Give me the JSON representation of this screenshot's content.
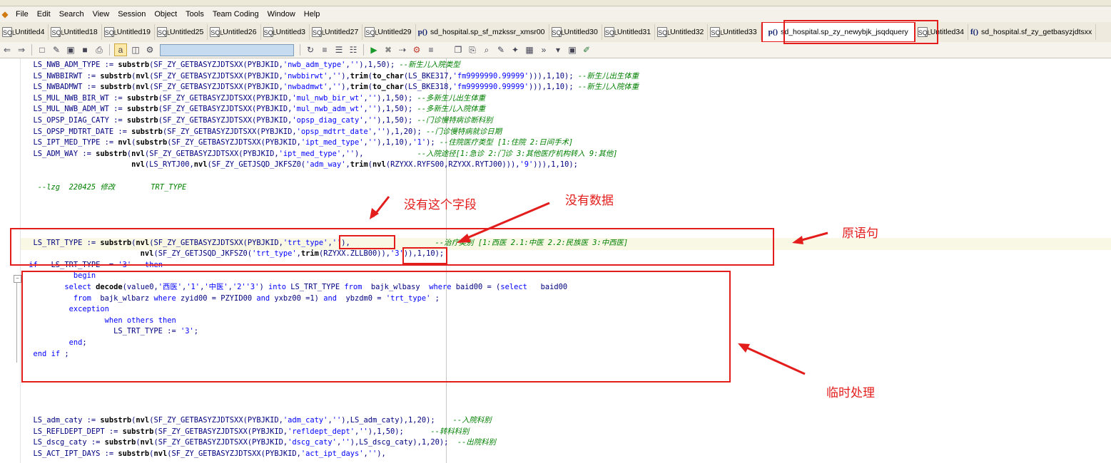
{
  "menubar": {
    "items": [
      "File",
      "Edit",
      "Search",
      "View",
      "Session",
      "Object",
      "Tools",
      "Team Coding",
      "Window",
      "Help"
    ]
  },
  "tabs": [
    {
      "label": "Untitled4",
      "icon": "sql-icon"
    },
    {
      "label": "Untitled18",
      "icon": "sql-icon"
    },
    {
      "label": "Untitled19",
      "icon": "sql-icon"
    },
    {
      "label": "Untitled25",
      "icon": "sql-icon"
    },
    {
      "label": "Untitled26",
      "icon": "sql-icon"
    },
    {
      "label": "Untitled3",
      "icon": "sql-icon"
    },
    {
      "label": "Untitled27",
      "icon": "sql-icon"
    },
    {
      "label": "Untitled29",
      "icon": "sql-icon"
    },
    {
      "label": "sd_hospital.sp_sf_mzkssr_xmsr00",
      "icon": "procedure-icon",
      "glyph": "p()"
    },
    {
      "label": "Untitled30",
      "icon": "sql-icon"
    },
    {
      "label": "Untitled31",
      "icon": "sql-icon"
    },
    {
      "label": "Untitled32",
      "icon": "sql-icon"
    },
    {
      "label": "Untitled33",
      "icon": "sql-icon"
    },
    {
      "label": "sd_hospital.sp_zy_newybjk_jsqdquery",
      "icon": "procedure-icon",
      "glyph": "p()",
      "active": true
    },
    {
      "label": "Untitled34",
      "icon": "sql-icon"
    },
    {
      "label": "sd_hospital.sf_zy_getbasyzjdtsxx",
      "icon": "function-icon",
      "glyph": "f()"
    }
  ],
  "tab_icon_glyph": "SQL",
  "toolbar": {
    "object_filter_value": ""
  },
  "code": {
    "lines": [
      "  LS_NWB_ADM_TYPE := substrb(SF_ZY_GETBASYZJDTSXX(PYBJKID,'nwb_adm_type',''),1,50); --新生儿入院类型",
      "  LS_NWBBIRWT := substrb(nvl(SF_ZY_GETBASYZJDTSXX(PYBJKID,'nwbbirwt',''),trim(to_char(LS_BKE317,'fm9999990.99999'))),1,10); --新生儿出生体重",
      "  LS_NWBADMWT := substrb(nvl(SF_ZY_GETBASYZJDTSXX(PYBJKID,'nwbadmwt',''),trim(to_char(LS_BKE318,'fm9999990.99999'))),1,10); --新生儿入院体重",
      "  LS_MUL_NWB_BIR_WT := substrb(SF_ZY_GETBASYZJDTSXX(PYBJKID,'mul_nwb_bir_wt',''),1,50); --多新生儿出生体重",
      "  LS_MUL_NWB_ADM_WT := substrb(SF_ZY_GETBASYZJDTSXX(PYBJKID,'mul_nwb_adm_wt',''),1,50); --多新生儿入院体重",
      "  LS_OPSP_DIAG_CATY := substrb(SF_ZY_GETBASYZJDTSXX(PYBJKID,'opsp_diag_caty',''),1,50); --门诊慢特病诊断科别",
      "  LS_OPSP_MDTRT_DATE := substrb(SF_ZY_GETBASYZJDTSXX(PYBJKID,'opsp_mdtrt_date',''),1,20); --门诊慢特病就诊日期",
      "  LS_IPT_MED_TYPE := nvl(substrb(SF_ZY_GETBASYZJDTSXX(PYBJKID,'ipt_med_type',''),1,10),'1'); --住院医疗类型 [1:住院 2:日间手术]",
      "  LS_ADM_WAY := substrb(nvl(SF_ZY_GETBASYZJDTSXX(PYBJKID,'ipt_med_type',''),            --入院途径[1:急诊 2:门诊 3:其他医疗机构转入 9:其他]",
      "                        nvl(LS_RYTJ00,nvl(SF_ZY_GETJSQD_JKFSZ0('adm_way',trim(nvl(RZYXX.RYFS00,RZYXX.RYTJ00))),'9'))),1,10);",
      "",
      "   --lzg  220425 修改        TRT_TYPE",
      "",
      "",
      "",
      "",
      "  LS_TRT_TYPE := substrb(nvl(SF_ZY_GETBASYZJDTSXX(PYBJKID,'trt_type',''),                   --治疗类别 [1:西医 2.1:中医 2.2:民族医 3:中西医]",
      "                          nvl(SF_ZY_GETJSQD_JKFSZ0('trt_type',trim(RZYXX.ZLLB00)),'3')),1,10);",
      " if   LS_TRT_TYPE  = '3'   then",
      "           begin",
      "         select decode(value0,'西医','1','中医','2''3') into LS_TRT_TYPE from  bajk_wlbasy  where baid00 = (select   baid00",
      "           from  bajk_wlbarz where zyid00 = PZYID00 and yxbz00 =1) and  ybzdm0 = 'trt_type' ;",
      "          exception",
      "                  when others then",
      "                    LS_TRT_TYPE := '3';",
      "          end;",
      "  end if ;",
      "",
      "",
      "",
      "",
      "",
      "  LS_adm_caty := substrb(nvl(SF_ZY_GETBASYZJDTSXX(PYBJKID,'adm_caty',''),LS_adm_caty),1,20);    --入院科别",
      "  LS_REFLDEPT_DEPT := substrb(SF_ZY_GETBASYZJDTSXX(PYBJKID,'refldept_dept',''),1,50);      --转科科别",
      "  LS_dscg_caty := substrb(nvl(SF_ZY_GETBASYZJDTSXX(PYBJKID,'dscg_caty',''),LS_dscg_caty),1,20);  --出院科别",
      "  LS_ACT_IPT_DAYS := substrb(nvl(SF_ZY_GETBASYZJDTSXX(PYBJKID,'act_ipt_days',''),"
    ]
  },
  "annotations": {
    "no_field": "没有这个字段",
    "no_data": "没有数据",
    "original_statement": "原语句",
    "temporary_fix": "临时处理"
  },
  "colors": {
    "annotation_red": "#e31c1c",
    "keyword_blue": "#0000ff",
    "comment_green": "#008000",
    "identifier_navy": "#000080",
    "active_tab_outline": "#e31c1c"
  }
}
